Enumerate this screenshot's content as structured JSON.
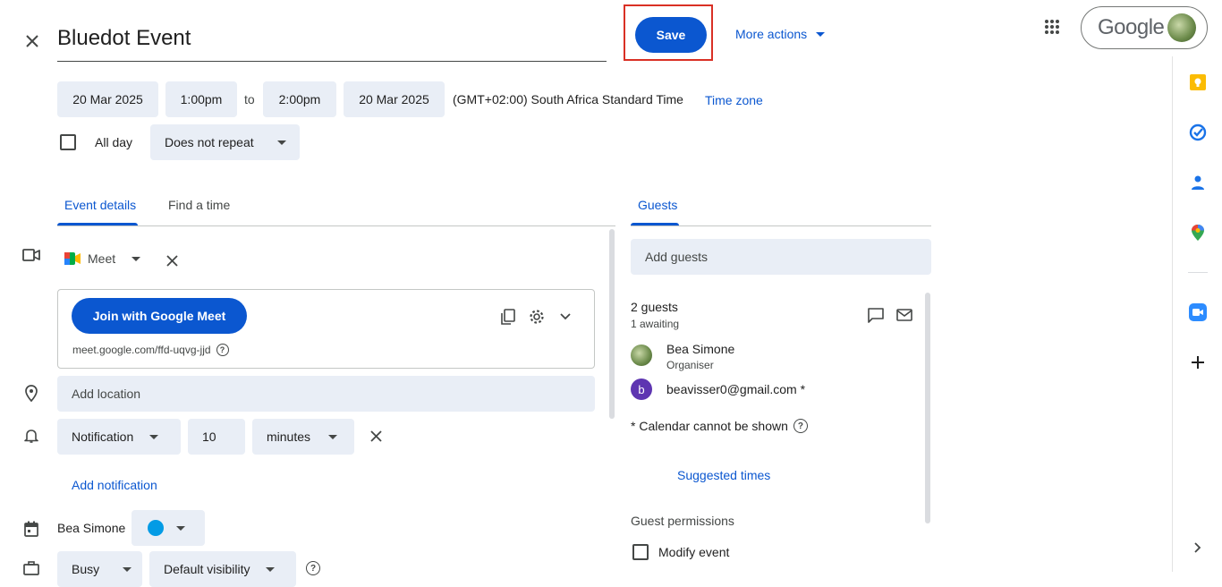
{
  "header": {
    "title": "Bluedot Event",
    "save_label": "Save",
    "more_actions_label": "More actions",
    "google_label": "Google"
  },
  "datetime": {
    "start_date": "20 Mar 2025",
    "start_time": "1:00pm",
    "to_label": "to",
    "end_time": "2:00pm",
    "end_date": "20 Mar 2025",
    "timezone_text": "(GMT+02:00) South Africa Standard Time",
    "timezone_link": "Time zone",
    "all_day_label": "All day",
    "repeat_value": "Does not repeat"
  },
  "tabs": {
    "event_details": "Event details",
    "find_a_time": "Find a time",
    "guests": "Guests"
  },
  "meet": {
    "label": "Meet",
    "join_label": "Join with Google Meet",
    "link": "meet.google.com/ffd-uqvg-jjd"
  },
  "location": {
    "placeholder": "Add location"
  },
  "notification": {
    "type": "Notification",
    "value": "10",
    "unit": "minutes",
    "add_label": "Add notification"
  },
  "owner": {
    "name": "Bea Simone",
    "color": "#039be5"
  },
  "availability": {
    "busy": "Busy",
    "visibility": "Default visibility"
  },
  "guests": {
    "add_placeholder": "Add guests",
    "count": "2 guests",
    "awaiting": "1 awaiting",
    "list": [
      {
        "name": "Bea Simone",
        "role": "Organiser",
        "avatar": ""
      },
      {
        "name": "beavisser0@gmail.com *",
        "role": "",
        "avatar": "b"
      }
    ],
    "calendar_note": "* Calendar cannot be shown",
    "suggested_times": "Suggested times",
    "permissions_label": "Guest permissions",
    "modify_event": "Modify event"
  },
  "colors": {
    "accent": "#0b57d0",
    "chip": "#e9eef6",
    "save_highlight": "#d93025"
  }
}
